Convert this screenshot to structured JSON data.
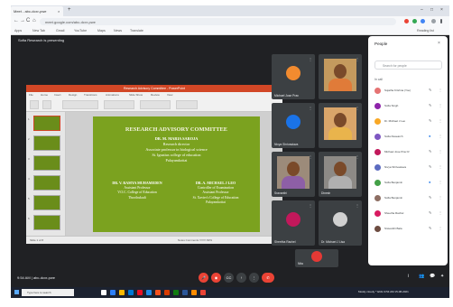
{
  "browser": {
    "tab_title": "Meet - abc-dcxr-pwe",
    "tab_close": "×",
    "new_tab": "+",
    "minimize": "–",
    "maximize": "□",
    "close": "×",
    "back": "←",
    "forward": "→",
    "reload": "C",
    "home": "⌂",
    "url": "meet.google.com/abc-dcxr-pwe",
    "bookmarks": [
      "Apps",
      "New Tab",
      "Gmail",
      "YouTube",
      "Maps",
      "News",
      "Translate"
    ],
    "reading_list": "Reading list"
  },
  "meet": {
    "presenting_banner": "Sofia Research is presenting",
    "meeting_code": "9:54 AM  |  abc-dcxr-pwe",
    "participant_tiles": [
      {
        "name": "Michael Jose Prav",
        "mic": "⋮",
        "avatar_color": "#f28b2f"
      },
      {
        "name": "",
        "mic": "⋮",
        "type": "photo"
      },
      {
        "name": "Nivya Shrivastava",
        "mic": "⋮",
        "avatar_color": "#1a73e8"
      },
      {
        "name": "",
        "mic": "⋮",
        "type": "photo"
      },
      {
        "name": "Sravanthi",
        "mic": "⋮",
        "type": "photo"
      },
      {
        "name": "Dinesh",
        "mic": "⋮",
        "type": "photo"
      },
      {
        "name": "Sheetha Rachel",
        "mic": "⋮",
        "avatar_color": "#c2185b"
      },
      {
        "name": "Dr. Michael J Lisa",
        "mic": "⋮",
        "avatar_color": "#8e8e8e"
      },
      {
        "name": "Nita",
        "mic": "⋮",
        "avatar_color": "#e53935"
      }
    ],
    "controls": {
      "mic": "🎤",
      "camera": "◉",
      "captions": "CC",
      "present": "↑",
      "more": "⋮",
      "end_call": "✆"
    },
    "side_icons": [
      "i",
      "👥",
      "💬",
      "✦"
    ]
  },
  "powerpoint": {
    "title_bar": "Research Advisory Committee - PowerPoint",
    "ribbon_tabs": [
      "File",
      "Home",
      "Insert",
      "Design",
      "Transitions",
      "Animations",
      "Slide Show",
      "Review",
      "View"
    ],
    "status_left": "Slide 1 of 8",
    "status_right": "Notes   Comments   ━━━━  82%",
    "thumb_numbers": [
      "1",
      "2",
      "3",
      "4",
      "5",
      "6"
    ]
  },
  "slide": {
    "title": "RESEARCH ADVISORY COMMITTEE",
    "main_name": "DR. M. MARIA SAROJA",
    "main_lines": [
      "Research director",
      "Associate professor in biological science",
      "St. Ignatius college of education",
      "Palayamkottai"
    ],
    "left_name": "DR. V. RAMYA MUHAMEDEN",
    "left_lines": [
      "Assistant Professor",
      "V.O.C. College of Education",
      "Thoothukudi"
    ],
    "right_name": "DR. A. MICHAEL J LEO",
    "right_lines": [
      "Controller of Examination",
      "Assistant Professor",
      "St. Xavier's College of Education",
      "Palayamkottai"
    ]
  },
  "people_panel": {
    "title": "People",
    "close": "×",
    "search_placeholder": "Search for people",
    "in_meeting_label": "In call",
    "participants": [
      {
        "name": "Sujatha Krishna (You)",
        "avatar": "#e57373"
      },
      {
        "name": "Sofia Singh",
        "avatar": "#8e24aa"
      },
      {
        "name": "Dr. Michael J Leo",
        "avatar": "#f9a825"
      },
      {
        "name": "Sofia Research",
        "avatar": "#7e57c2"
      },
      {
        "name": "Michael Jose Prav R",
        "avatar": "#c2185b"
      },
      {
        "name": "Nivya Shrivastava",
        "avatar": "#5c6bc0"
      },
      {
        "name": "Sofia Benjamin",
        "avatar": "#43a047"
      },
      {
        "name": "Sofia Benjamin",
        "avatar": "#8d6e63"
      },
      {
        "name": "Sheetha Rachel",
        "avatar": "#d81b60"
      },
      {
        "name": "Sravanthi Bala",
        "avatar": "#6d4c41"
      }
    ],
    "mic_icon": "✎",
    "more_icon": "⋮"
  },
  "taskbar": {
    "search_placeholder": "Type here to search",
    "tray_text": "Mostly cloudy  ^  ENG  9:54 AM  15-08-2021",
    "app_colors": [
      "#ffffff",
      "#2d7ff9",
      "#ffb900",
      "#0078d4",
      "#e81123",
      "#1e88e5",
      "#f4511e",
      "#d83b01",
      "#107c10",
      "#2b579a",
      "#ff8c00",
      "#ea4335"
    ]
  }
}
